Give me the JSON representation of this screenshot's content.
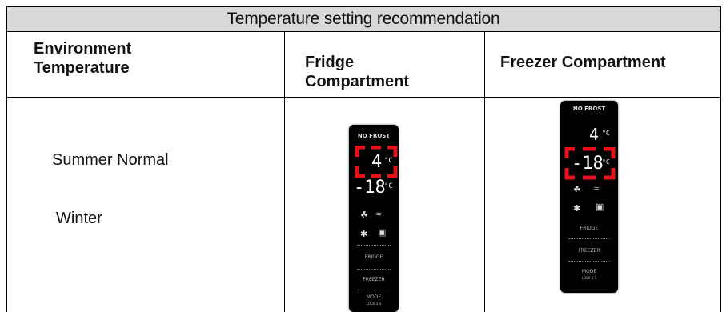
{
  "table": {
    "title": "Temperature setting recommendation",
    "headers": {
      "environment": "Environment\nTemperature",
      "fridge": "Fridge\nCompartment",
      "freezer": "Freezer Compartment"
    },
    "rows": {
      "summer_normal": "Summer Normal",
      "winter": "Winter"
    }
  },
  "panels": {
    "fridge": {
      "brand": "NO FROST",
      "top_temp": "4",
      "bottom_temp": "-18",
      "unit": "°C",
      "highlighted": "top",
      "buttons": [
        "FRIDGE",
        "FREEZER",
        "MODE"
      ],
      "mode_sub": "LOCK 3 S"
    },
    "freezer": {
      "brand": "NO FROST",
      "top_temp": "4",
      "bottom_temp": "-18",
      "unit": "°C",
      "highlighted": "bottom",
      "buttons": [
        "FRIDGE",
        "FREEZER",
        "MODE"
      ],
      "mode_sub": "LOCK 3 S"
    },
    "highlight_color": "#e8101a"
  }
}
